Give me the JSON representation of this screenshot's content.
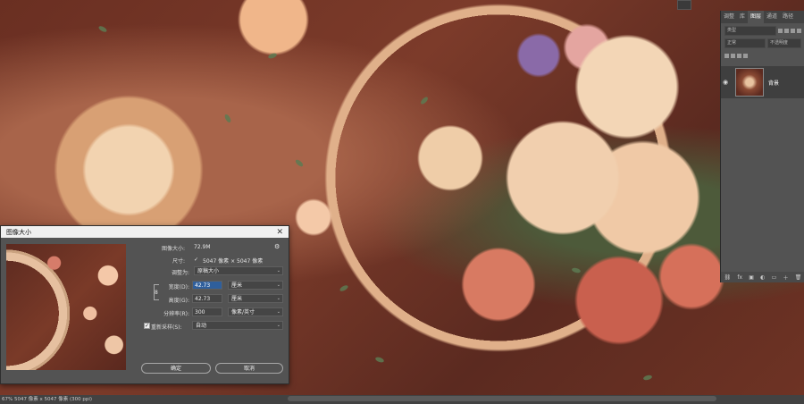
{
  "panel": {
    "tabs": [
      "调整",
      "库",
      "图层",
      "通道",
      "路径"
    ],
    "active_tab": "图层",
    "filter_placeholder": "类型",
    "blend_mode": "正常",
    "opacity_label": "不透明度",
    "layer_name": "背景"
  },
  "dialog": {
    "title": "图像大小",
    "image_size_label": "图像大小:",
    "image_size_value": "72.9M",
    "dimensions_label": "尺寸:",
    "dimensions_value": "5047 像素 × 5047 像素",
    "fit_label": "调整为:",
    "fit_value": "原稿大小",
    "width_label": "宽度(D):",
    "width_value": "42.73",
    "width_unit": "厘米",
    "height_label": "高度(G):",
    "height_value": "42.73",
    "height_unit": "厘米",
    "resolution_label": "分辨率(R):",
    "resolution_value": "300",
    "resolution_unit": "像素/英寸",
    "resample_label": "重新采样(S):",
    "resample_value": "自动",
    "ok_label": "确定",
    "cancel_label": "取消"
  },
  "status": {
    "text": "67%   5047 像素 x 5047 像素 (300 ppi)"
  }
}
